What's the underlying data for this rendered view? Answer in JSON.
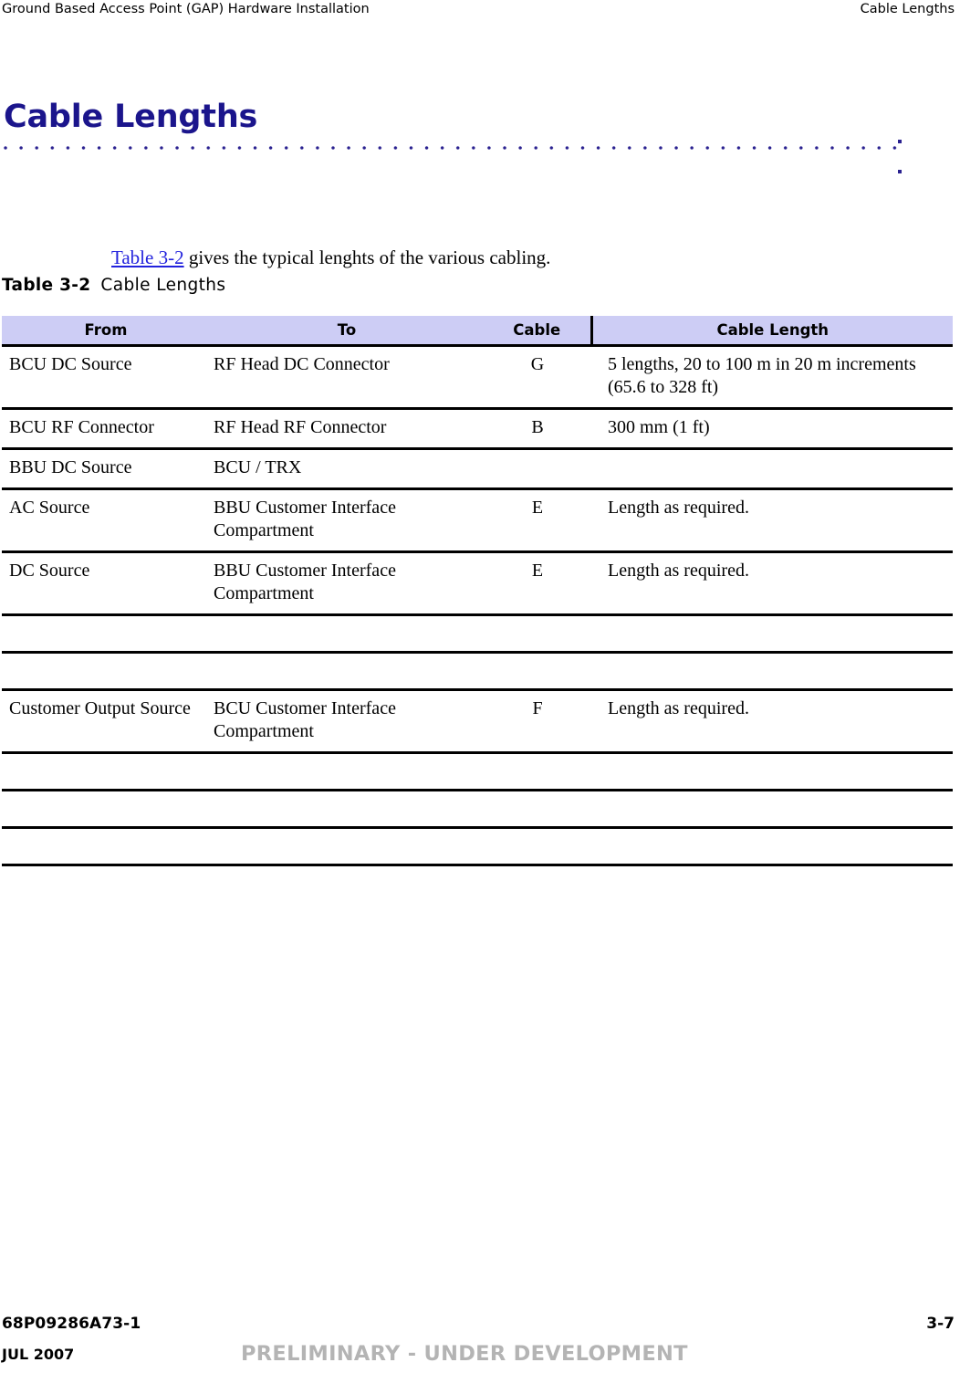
{
  "header": {
    "left_title": "Ground Based Access Point (GAP) Hardware Installation",
    "right_title": "Cable Lengths"
  },
  "title": {
    "text": "Cable Lengths",
    "color": "#1b158c",
    "rule_color": "#2a2190"
  },
  "intro": {
    "xref": "Table 3-2",
    "rest": " gives the typical lenghts of the various cabling."
  },
  "table_caption": {
    "number": "Table 3-2",
    "text": "Cable Lengths"
  },
  "table": {
    "header_background": "#cdcdf5",
    "columns": [
      "From",
      "To",
      "Cable",
      "Cable Length"
    ],
    "rows": [
      {
        "from": "BCU DC Source",
        "to": "RF Head DC Connector",
        "cable": "G",
        "length": "5 lengths, 20 to 100 m in 20 m increments (65.6 to 328 ft)"
      },
      {
        "from": "BCU RF Connector",
        "to": "RF Head RF Connector",
        "cable": "B",
        "length": "300 mm (1 ft)"
      },
      {
        "from": "BBU DC Source",
        "to": "BCU / TRX",
        "cable": "",
        "length": ""
      },
      {
        "from": "AC Source",
        "to": "BBU Customer Interface Compartment",
        "cable": "E",
        "length": "Length as required."
      },
      {
        "from": "DC Source",
        "to": "BBU Customer Interface Compartment",
        "cable": "E",
        "length": "Length as required."
      },
      {
        "from": "",
        "to": "",
        "cable": "",
        "length": ""
      },
      {
        "from": "",
        "to": "",
        "cable": "",
        "length": ""
      },
      {
        "from": "Customer Output Source",
        "to": "BCU Customer Interface Compartment",
        "cable": "F",
        "length": "Length as required."
      },
      {
        "from": "",
        "to": "",
        "cable": "",
        "length": ""
      },
      {
        "from": "",
        "to": "",
        "cable": "",
        "length": ""
      },
      {
        "from": "",
        "to": "",
        "cable": "",
        "length": ""
      }
    ]
  },
  "footer": {
    "doc_number": "68P09286A73-1",
    "date": "JUL 2007",
    "page_number": "3-7",
    "stamp": "PRELIMINARY - UNDER DEVELOPMENT",
    "stamp_color": "#b4b4b4"
  }
}
